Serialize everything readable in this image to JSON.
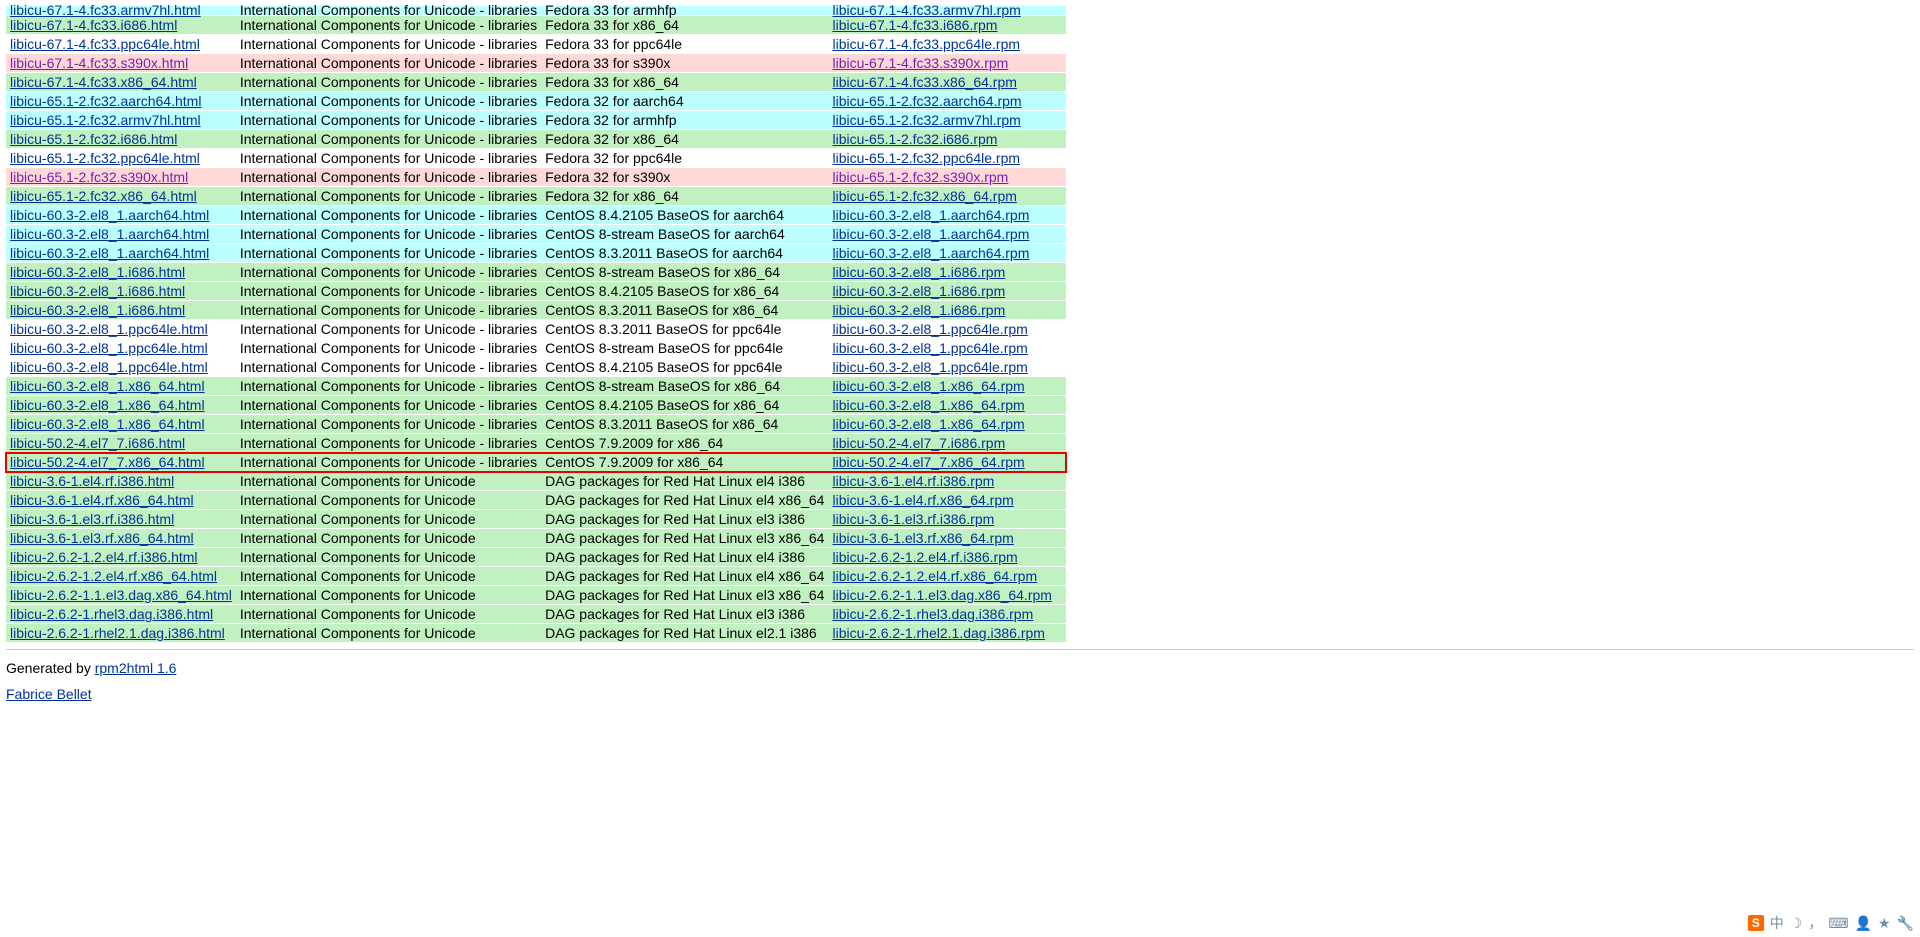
{
  "desc_full": "International Components for Unicode - libraries",
  "desc_short": "International Components for Unicode",
  "rows": [
    {
      "cls": "aqua",
      "h": "libicu-67.1-4.fc33.armv7hl.html",
      "d": "Fedora 33 for armhfp",
      "r": "libicu-67.1-4.fc33.armv7hl.rpm",
      "full": true,
      "clip": true,
      "visited": false
    },
    {
      "cls": "green",
      "h": "libicu-67.1-4.fc33.i686.html",
      "d": "Fedora 33 for x86_64",
      "r": "libicu-67.1-4.fc33.i686.rpm",
      "full": true
    },
    {
      "cls": "white",
      "h": "libicu-67.1-4.fc33.ppc64le.html",
      "d": "Fedora 33 for ppc64le",
      "r": "libicu-67.1-4.fc33.ppc64le.rpm",
      "full": true
    },
    {
      "cls": "pink",
      "h": "libicu-67.1-4.fc33.s390x.html",
      "d": "Fedora 33 for s390x",
      "r": "libicu-67.1-4.fc33.s390x.rpm",
      "full": true,
      "visited": true
    },
    {
      "cls": "green",
      "h": "libicu-67.1-4.fc33.x86_64.html",
      "d": "Fedora 33 for x86_64",
      "r": "libicu-67.1-4.fc33.x86_64.rpm",
      "full": true
    },
    {
      "cls": "aqua",
      "h": "libicu-65.1-2.fc32.aarch64.html",
      "d": "Fedora 32 for aarch64",
      "r": "libicu-65.1-2.fc32.aarch64.rpm",
      "full": true
    },
    {
      "cls": "aqua",
      "h": "libicu-65.1-2.fc32.armv7hl.html",
      "d": "Fedora 32 for armhfp",
      "r": "libicu-65.1-2.fc32.armv7hl.rpm",
      "full": true
    },
    {
      "cls": "green",
      "h": "libicu-65.1-2.fc32.i686.html",
      "d": "Fedora 32 for x86_64",
      "r": "libicu-65.1-2.fc32.i686.rpm",
      "full": true
    },
    {
      "cls": "white",
      "h": "libicu-65.1-2.fc32.ppc64le.html",
      "d": "Fedora 32 for ppc64le",
      "r": "libicu-65.1-2.fc32.ppc64le.rpm",
      "full": true
    },
    {
      "cls": "pink",
      "h": "libicu-65.1-2.fc32.s390x.html",
      "d": "Fedora 32 for s390x",
      "r": "libicu-65.1-2.fc32.s390x.rpm",
      "full": true,
      "visited": true
    },
    {
      "cls": "green",
      "h": "libicu-65.1-2.fc32.x86_64.html",
      "d": "Fedora 32 for x86_64",
      "r": "libicu-65.1-2.fc32.x86_64.rpm",
      "full": true
    },
    {
      "cls": "aqua",
      "h": "libicu-60.3-2.el8_1.aarch64.html",
      "d": "CentOS 8.4.2105 BaseOS for aarch64",
      "r": "libicu-60.3-2.el8_1.aarch64.rpm",
      "full": true
    },
    {
      "cls": "aqua",
      "h": "libicu-60.3-2.el8_1.aarch64.html",
      "d": "CentOS 8-stream BaseOS for aarch64",
      "r": "libicu-60.3-2.el8_1.aarch64.rpm",
      "full": true
    },
    {
      "cls": "aqua",
      "h": "libicu-60.3-2.el8_1.aarch64.html",
      "d": "CentOS 8.3.2011 BaseOS for aarch64",
      "r": "libicu-60.3-2.el8_1.aarch64.rpm",
      "full": true
    },
    {
      "cls": "green",
      "h": "libicu-60.3-2.el8_1.i686.html",
      "d": "CentOS 8-stream BaseOS for x86_64",
      "r": "libicu-60.3-2.el8_1.i686.rpm",
      "full": true
    },
    {
      "cls": "green",
      "h": "libicu-60.3-2.el8_1.i686.html",
      "d": "CentOS 8.4.2105 BaseOS for x86_64",
      "r": "libicu-60.3-2.el8_1.i686.rpm",
      "full": true
    },
    {
      "cls": "green",
      "h": "libicu-60.3-2.el8_1.i686.html",
      "d": "CentOS 8.3.2011 BaseOS for x86_64",
      "r": "libicu-60.3-2.el8_1.i686.rpm",
      "full": true
    },
    {
      "cls": "white",
      "h": "libicu-60.3-2.el8_1.ppc64le.html",
      "d": "CentOS 8.3.2011 BaseOS for ppc64le",
      "r": "libicu-60.3-2.el8_1.ppc64le.rpm",
      "full": true
    },
    {
      "cls": "white",
      "h": "libicu-60.3-2.el8_1.ppc64le.html",
      "d": "CentOS 8-stream BaseOS for ppc64le",
      "r": "libicu-60.3-2.el8_1.ppc64le.rpm",
      "full": true
    },
    {
      "cls": "white",
      "h": "libicu-60.3-2.el8_1.ppc64le.html",
      "d": "CentOS 8.4.2105 BaseOS for ppc64le",
      "r": "libicu-60.3-2.el8_1.ppc64le.rpm",
      "full": true
    },
    {
      "cls": "green",
      "h": "libicu-60.3-2.el8_1.x86_64.html",
      "d": "CentOS 8-stream BaseOS for x86_64",
      "r": "libicu-60.3-2.el8_1.x86_64.rpm",
      "full": true
    },
    {
      "cls": "green",
      "h": "libicu-60.3-2.el8_1.x86_64.html",
      "d": "CentOS 8.4.2105 BaseOS for x86_64",
      "r": "libicu-60.3-2.el8_1.x86_64.rpm",
      "full": true
    },
    {
      "cls": "green",
      "h": "libicu-60.3-2.el8_1.x86_64.html",
      "d": "CentOS 8.3.2011 BaseOS for x86_64",
      "r": "libicu-60.3-2.el8_1.x86_64.rpm",
      "full": true
    },
    {
      "cls": "green",
      "h": "libicu-50.2-4.el7_7.i686.html",
      "d": "CentOS 7.9.2009 for x86_64",
      "r": "libicu-50.2-4.el7_7.i686.rpm",
      "full": true
    },
    {
      "cls": "green",
      "h": "libicu-50.2-4.el7_7.x86_64.html",
      "d": "CentOS 7.9.2009 for x86_64",
      "r": "libicu-50.2-4.el7_7.x86_64.rpm",
      "full": true,
      "red": true
    },
    {
      "cls": "green",
      "h": "libicu-3.6-1.el4.rf.i386.html",
      "d": "DAG packages for Red Hat Linux el4 i386",
      "r": "libicu-3.6-1.el4.rf.i386.rpm",
      "full": false
    },
    {
      "cls": "green",
      "h": "libicu-3.6-1.el4.rf.x86_64.html",
      "d": "DAG packages for Red Hat Linux el4 x86_64",
      "r": "libicu-3.6-1.el4.rf.x86_64.rpm",
      "full": false
    },
    {
      "cls": "green",
      "h": "libicu-3.6-1.el3.rf.i386.html",
      "d": "DAG packages for Red Hat Linux el3 i386",
      "r": "libicu-3.6-1.el3.rf.i386.rpm",
      "full": false
    },
    {
      "cls": "green",
      "h": "libicu-3.6-1.el3.rf.x86_64.html",
      "d": "DAG packages for Red Hat Linux el3 x86_64",
      "r": "libicu-3.6-1.el3.rf.x86_64.rpm",
      "full": false
    },
    {
      "cls": "green",
      "h": "libicu-2.6.2-1.2.el4.rf.i386.html",
      "d": "DAG packages for Red Hat Linux el4 i386",
      "r": "libicu-2.6.2-1.2.el4.rf.i386.rpm",
      "full": false
    },
    {
      "cls": "green",
      "h": "libicu-2.6.2-1.2.el4.rf.x86_64.html",
      "d": "DAG packages for Red Hat Linux el4 x86_64",
      "r": "libicu-2.6.2-1.2.el4.rf.x86_64.rpm",
      "full": false
    },
    {
      "cls": "green",
      "h": "libicu-2.6.2-1.1.el3.dag.x86_64.html",
      "d": "DAG packages for Red Hat Linux el3 x86_64",
      "r": "libicu-2.6.2-1.1.el3.dag.x86_64.rpm",
      "full": false
    },
    {
      "cls": "green",
      "h": "libicu-2.6.2-1.rhel3.dag.i386.html",
      "d": "DAG packages for Red Hat Linux el3 i386",
      "r": "libicu-2.6.2-1.rhel3.dag.i386.rpm",
      "full": false
    },
    {
      "cls": "green",
      "h": "libicu-2.6.2-1.rhel2.1.dag.i386.html",
      "d": "DAG packages for Red Hat Linux el2.1 i386",
      "r": "libicu-2.6.2-1.rhel2.1.dag.i386.rpm",
      "full": false
    }
  ],
  "footer_prefix": "Generated by ",
  "footer_link": "rpm2html 1.6",
  "author": "Fabrice Bellet",
  "tray": {
    "s": "S",
    "cn": "中",
    "moon": "☽",
    "comma": "，",
    "kb": "⌨",
    "user": "👤",
    "star": "★",
    "wrench": "🔧"
  }
}
